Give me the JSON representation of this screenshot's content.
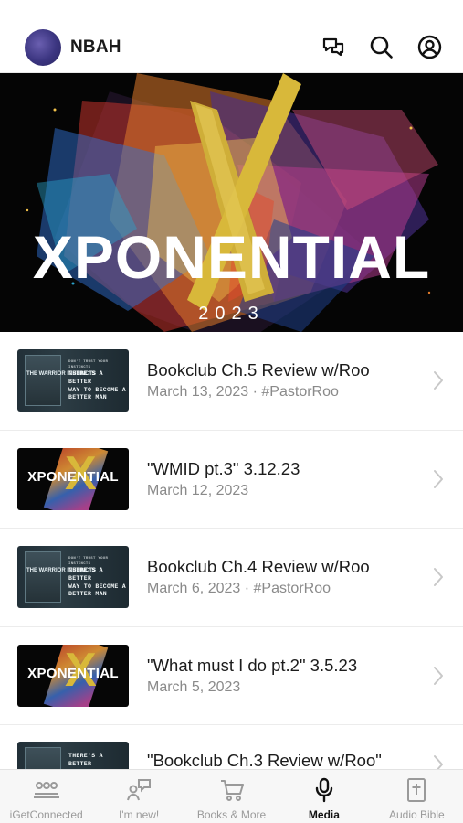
{
  "header": {
    "title": "NBAH"
  },
  "hero": {
    "title": "XPONENTIAL",
    "year": "2023"
  },
  "media_items": [
    {
      "title": "Bookclub Ch.5 Review w/Roo",
      "subtitle": "March 13, 2023 · #PastorRoo",
      "thumb": "bookclub"
    },
    {
      "title": "\"WMID pt.3\" 3.12.23",
      "subtitle": "March 12, 2023",
      "thumb": "xponential"
    },
    {
      "title": "Bookclub Ch.4 Review w/Roo",
      "subtitle": "March 6, 2023 · #PastorRoo",
      "thumb": "bookclub"
    },
    {
      "title": "\"What must I do pt.2\" 3.5.23",
      "subtitle": "March 5, 2023",
      "thumb": "xponential"
    },
    {
      "title": "\"Bookclub Ch.3 Review w/Roo\"",
      "subtitle": "",
      "thumb": "bookclub"
    }
  ],
  "thumbs": {
    "bookclub_cover": "THE WARRIOR INSTINCTS",
    "bookclub_lines": [
      "DON'T TRUST YOUR INSTINCTS",
      "THERE'S A BETTER",
      "WAY TO BECOME A",
      "BETTER MAN"
    ],
    "xponential_word": "XPONENTIAL"
  },
  "tabs": [
    {
      "label": "iGetConnected",
      "icon": "people-group-icon",
      "active": false
    },
    {
      "label": "I'm new!",
      "icon": "person-chat-icon",
      "active": false
    },
    {
      "label": "Books & More",
      "icon": "cart-icon",
      "active": false
    },
    {
      "label": "Media",
      "icon": "microphone-icon",
      "active": true
    },
    {
      "label": "Audio Bible",
      "icon": "bible-icon",
      "active": false
    }
  ],
  "colors": {
    "hero_background": "#050505",
    "accent_gold": "#d8b83a",
    "active_tab": "#111111",
    "inactive_tab": "#9a9a9a"
  }
}
